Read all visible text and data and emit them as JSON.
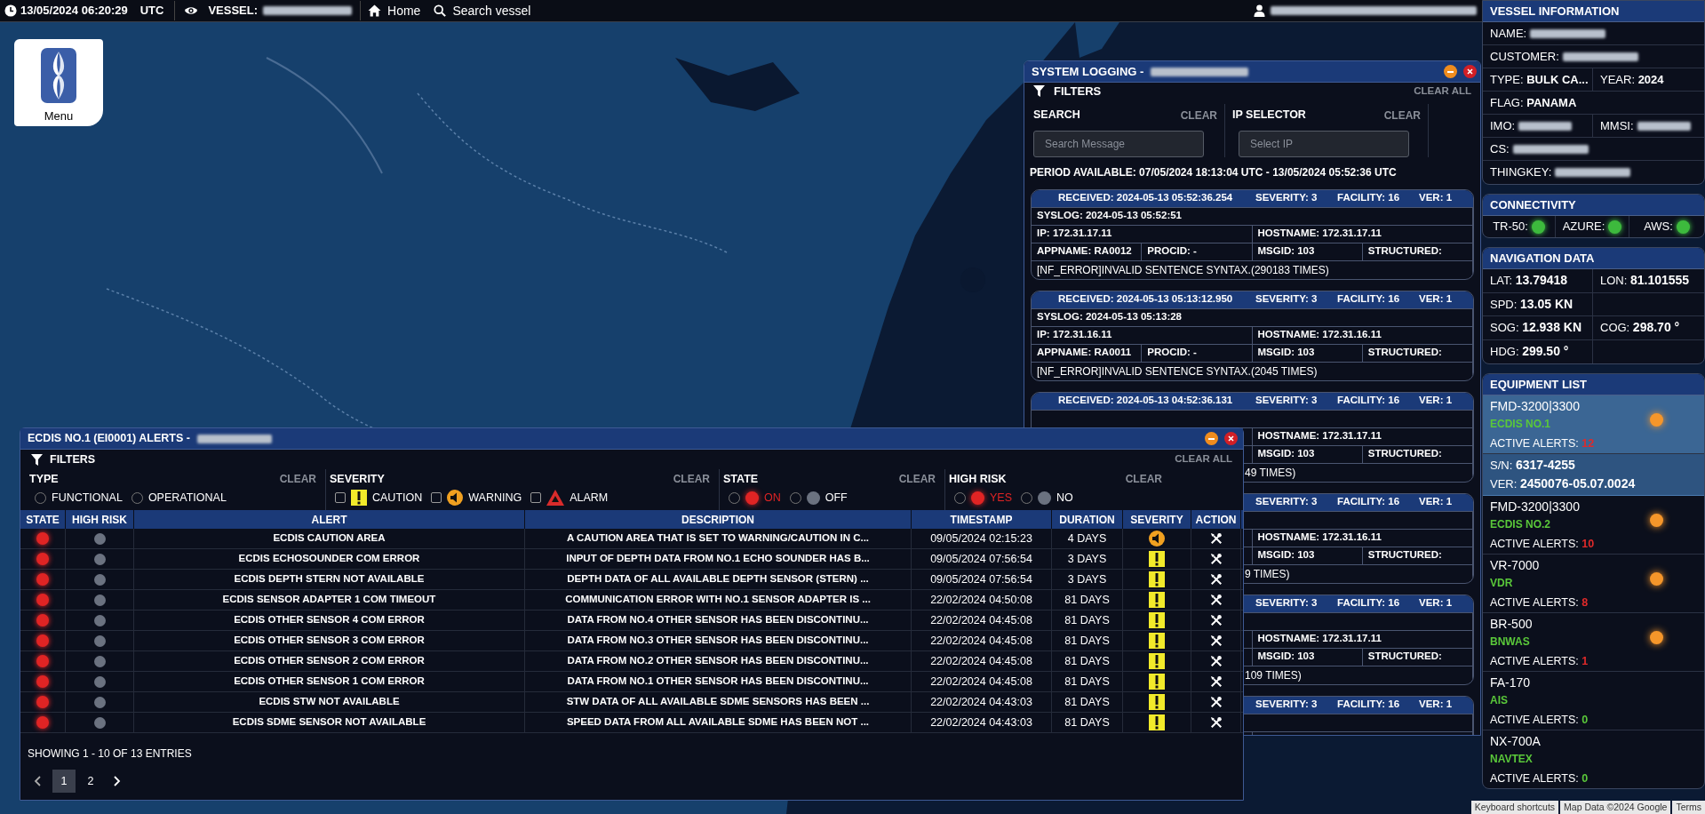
{
  "top_bar": {
    "datetime": "13/05/2024 06:20:29",
    "timezone": "UTC",
    "vessel_label": "VESSEL:",
    "home": "Home",
    "search": "Search vessel"
  },
  "menu_button": {
    "label": "Menu"
  },
  "system_logging": {
    "title": "SYSTEM LOGGING -",
    "filters_label": "FILTERS",
    "clear_all": "CLEAR ALL",
    "search": {
      "label": "SEARCH",
      "clear": "CLEAR",
      "placeholder": "Search Message"
    },
    "ip_selector": {
      "label": "IP SELECTOR",
      "clear": "CLEAR",
      "placeholder": "Select IP"
    },
    "period": "PERIOD AVAILABLE: 07/05/2024 18:13:04 UTC - 13/05/2024 05:52:36 UTC",
    "entries": [
      {
        "received": "RECEIVED: 2024-05-13 05:52:36.254",
        "severity": "SEVERITY: 3",
        "facility": "FACILITY: 16",
        "ver": "VER: 1",
        "syslog": "SYSLOG: 2024-05-13 05:52:51",
        "ip": "IP: 172.31.17.11",
        "hostname": "HOSTNAME: 172.31.17.11",
        "appname": "APPNAME: RA0012",
        "procid": "PROCID: -",
        "msgid": "MSGID: 103",
        "structured": "STRUCTURED:",
        "message": "[NF_ERROR]INVALID SENTENCE SYNTAX.(290183 TIMES)"
      },
      {
        "received": "RECEIVED: 2024-05-13 05:13:12.950",
        "severity": "SEVERITY: 3",
        "facility": "FACILITY: 16",
        "ver": "VER: 1",
        "syslog": "SYSLOG: 2024-05-13 05:13:28",
        "ip": "IP: 172.31.16.11",
        "hostname": "HOSTNAME: 172.31.16.11",
        "appname": "APPNAME: RA0011",
        "procid": "PROCID: -",
        "msgid": "MSGID: 103",
        "structured": "STRUCTURED:",
        "message": "[NF_ERROR]INVALID SENTENCE SYNTAX.(2045 TIMES)"
      },
      {
        "received": "RECEIVED: 2024-05-13 04:52:36.131",
        "severity": "SEVERITY: 3",
        "facility": "FACILITY: 16",
        "ver": "VER: 1",
        "hostname": "HOSTNAME: 172.31.17.11",
        "msgid": "MSGID: 103",
        "structured": "STRUCTURED:",
        "message": "49 TIMES)"
      },
      {
        "severity": "SEVERITY: 3",
        "facility": "FACILITY: 16",
        "ver": "VER: 1",
        "hostname": "HOSTNAME: 172.31.16.11",
        "msgid": "MSGID: 103",
        "structured": "STRUCTURED:",
        "message": "9 TIMES)"
      },
      {
        "severity": "SEVERITY: 3",
        "facility": "FACILITY: 16",
        "ver": "VER: 1",
        "hostname": "HOSTNAME: 172.31.17.11",
        "msgid": "MSGID: 103",
        "structured": "STRUCTURED:",
        "message": "109 TIMES)"
      },
      {
        "severity": "SEVERITY: 3",
        "facility": "FACILITY: 16",
        "ver": "VER: 1"
      }
    ]
  },
  "alerts_window": {
    "title": "ECDIS NO.1 (EI0001) ALERTS -",
    "filters_label": "FILTERS",
    "clear_all": "CLEAR ALL",
    "filter_groups": [
      {
        "label": "TYPE",
        "clear": "CLEAR",
        "options": [
          {
            "kind": "radio",
            "label": "FUNCTIONAL",
            "selected": false
          },
          {
            "kind": "radio",
            "label": "OPERATIONAL",
            "selected": false
          }
        ]
      },
      {
        "label": "SEVERITY",
        "clear": "CLEAR",
        "options": [
          {
            "kind": "caution",
            "label": "CAUTION",
            "checked": false
          },
          {
            "kind": "warning",
            "label": "WARNING",
            "checked": false
          },
          {
            "kind": "alarm",
            "label": "ALARM",
            "checked": false
          }
        ]
      },
      {
        "label": "STATE",
        "clear": "CLEAR",
        "options": [
          {
            "kind": "dot",
            "label": "ON",
            "selected": false,
            "color": "#e02424",
            "alert": true
          },
          {
            "kind": "dot",
            "label": "OFF",
            "selected": false,
            "color": "#6b7280",
            "alert": false
          }
        ]
      },
      {
        "label": "HIGH RISK",
        "clear": "CLEAR",
        "options": [
          {
            "kind": "dot",
            "label": "YES",
            "selected": false,
            "color": "#e02424",
            "alert": true
          },
          {
            "kind": "dot",
            "label": "NO",
            "selected": false,
            "color": "#6b7280",
            "alert": false
          }
        ]
      }
    ],
    "columns": [
      "STATE",
      "HIGH RISK",
      "ALERT",
      "DESCRIPTION",
      "TIMESTAMP",
      "DURATION",
      "SEVERITY",
      "ACTION"
    ],
    "rows": [
      {
        "kind": "warning",
        "active": true,
        "high_risk": false,
        "alert": "ECDIS CAUTION AREA",
        "description": "A CAUTION AREA THAT IS SET TO WARNING/CAUTION IN C...",
        "timestamp": "09/05/2024 02:15:23",
        "duration": "4 DAYS"
      },
      {
        "kind": "caution",
        "active": true,
        "high_risk": false,
        "alert": "ECDIS ECHOSOUNDER COM ERROR",
        "description": "INPUT OF DEPTH DATA FROM NO.1 ECHO SOUNDER HAS B...",
        "timestamp": "09/05/2024 07:56:54",
        "duration": "3 DAYS"
      },
      {
        "kind": "caution",
        "active": true,
        "high_risk": false,
        "alert": "ECDIS DEPTH STERN NOT AVAILABLE",
        "description": "DEPTH DATA OF ALL AVAILABLE DEPTH SENSOR (STERN) ...",
        "timestamp": "09/05/2024 07:56:54",
        "duration": "3 DAYS"
      },
      {
        "kind": "caution",
        "active": true,
        "high_risk": false,
        "alert": "ECDIS SENSOR ADAPTER 1 COM TIMEOUT",
        "description": "COMMUNICATION ERROR WITH NO.1 SENSOR ADAPTER IS ...",
        "timestamp": "22/02/2024 04:50:08",
        "duration": "81 DAYS"
      },
      {
        "kind": "caution",
        "active": true,
        "high_risk": false,
        "alert": "ECDIS OTHER SENSOR 4 COM ERROR",
        "description": "DATA FROM NO.4 OTHER SENSOR HAS BEEN DISCONTINU...",
        "timestamp": "22/02/2024 04:45:08",
        "duration": "81 DAYS"
      },
      {
        "kind": "caution",
        "active": true,
        "high_risk": false,
        "alert": "ECDIS OTHER SENSOR 3 COM ERROR",
        "description": "DATA FROM NO.3 OTHER SENSOR HAS BEEN DISCONTINU...",
        "timestamp": "22/02/2024 04:45:08",
        "duration": "81 DAYS"
      },
      {
        "kind": "caution",
        "active": true,
        "high_risk": false,
        "alert": "ECDIS OTHER SENSOR 2 COM ERROR",
        "description": "DATA FROM NO.2 OTHER SENSOR HAS BEEN DISCONTINU...",
        "timestamp": "22/02/2024 04:45:08",
        "duration": "81 DAYS"
      },
      {
        "kind": "caution",
        "active": true,
        "high_risk": false,
        "alert": "ECDIS OTHER SENSOR 1 COM ERROR",
        "description": "DATA FROM NO.1 OTHER SENSOR HAS BEEN DISCONTINU...",
        "timestamp": "22/02/2024 04:45:08",
        "duration": "81 DAYS"
      },
      {
        "kind": "caution",
        "active": true,
        "high_risk": false,
        "alert": "ECDIS STW NOT AVAILABLE",
        "description": "STW DATA OF ALL AVAILABLE SDME SENSORS HAS BEEN ...",
        "timestamp": "22/02/2024 04:43:03",
        "duration": "81 DAYS"
      },
      {
        "kind": "caution",
        "active": true,
        "high_risk": false,
        "alert": "ECDIS SDME SENSOR NOT AVAILABLE",
        "description": "SPEED DATA FROM ALL AVAILABLE SDME HAS BEEN NOT ...",
        "timestamp": "22/02/2024 04:43:03",
        "duration": "81 DAYS"
      }
    ],
    "showing": "SHOWING 1 - 10 OF 13 ENTRIES",
    "pages": [
      {
        "label": "1",
        "selected": true
      },
      {
        "label": "2",
        "selected": false
      }
    ]
  },
  "vessel_information": {
    "title": "VESSEL INFORMATION",
    "rows": [
      [
        {
          "label": "NAME:",
          "redacted": true
        }
      ],
      [
        {
          "label": "CUSTOMER:",
          "redacted": true
        }
      ],
      [
        {
          "text": "TYPE: **BULK CA...**"
        },
        {
          "text": "YEAR: **2024**"
        }
      ],
      [
        {
          "text": "FLAG: **PANAMA**"
        }
      ],
      [
        {
          "label": "IMO:",
          "redacted": true
        },
        {
          "label": "MMSI:",
          "redacted": true
        }
      ],
      [
        {
          "label": "CS:",
          "redacted": true
        }
      ],
      [
        {
          "label": "THINGKEY:",
          "redacted": true
        }
      ]
    ]
  },
  "connectivity": {
    "title": "CONNECTIVITY",
    "items": [
      {
        "label": "TR-50:",
        "on": true
      },
      {
        "label": "AZURE:",
        "on": true
      },
      {
        "label": "AWS:",
        "on": true
      }
    ]
  },
  "navigation_data": {
    "title": "NAVIGATION DATA",
    "rows": [
      [
        "LAT: **13.79418**",
        "LON: **81.101555**"
      ],
      [
        "SPD: **13.05 KN**"
      ],
      [
        "SOG: **12.938 KN**",
        "COG: **298.70 °**"
      ],
      [
        "HDG: **299.50 °**"
      ]
    ]
  },
  "equipment_list": {
    "title": "EQUIPMENT LIST",
    "items": [
      {
        "model": "FMD-3200|3300",
        "name": "ECDIS NO.1",
        "alerts_label": "ACTIVE ALERTS:",
        "alerts": "12",
        "alerting": true,
        "selected": true,
        "details": [
          "S/N: **6317-4255**",
          "VER: **2450076-05.07.0024**"
        ]
      },
      {
        "model": "FMD-3200|3300",
        "name": "ECDIS NO.2",
        "alerts_label": "ACTIVE ALERTS:",
        "alerts": "10",
        "alerting": true,
        "selected": false
      },
      {
        "model": "VR-7000",
        "name": "VDR",
        "alerts_label": "ACTIVE ALERTS:",
        "alerts": "8",
        "alerting": true,
        "selected": false
      },
      {
        "model": "BR-500",
        "name": "BNWAS",
        "alerts_label": "ACTIVE ALERTS:",
        "alerts": "1",
        "alerting": true,
        "selected": false
      },
      {
        "model": "FA-170",
        "name": "AIS",
        "alerts_label": "ACTIVE ALERTS:",
        "alerts": "0",
        "alerting": false,
        "selected": false
      },
      {
        "model": "NX-700A",
        "name": "NAVTEX",
        "alerts_label": "ACTIVE ALERTS:",
        "alerts": "0",
        "alerting": false,
        "selected": false
      }
    ]
  },
  "map_attribution": [
    "Keyboard shortcuts",
    "Map Data ©2024 Google",
    "Terms"
  ]
}
